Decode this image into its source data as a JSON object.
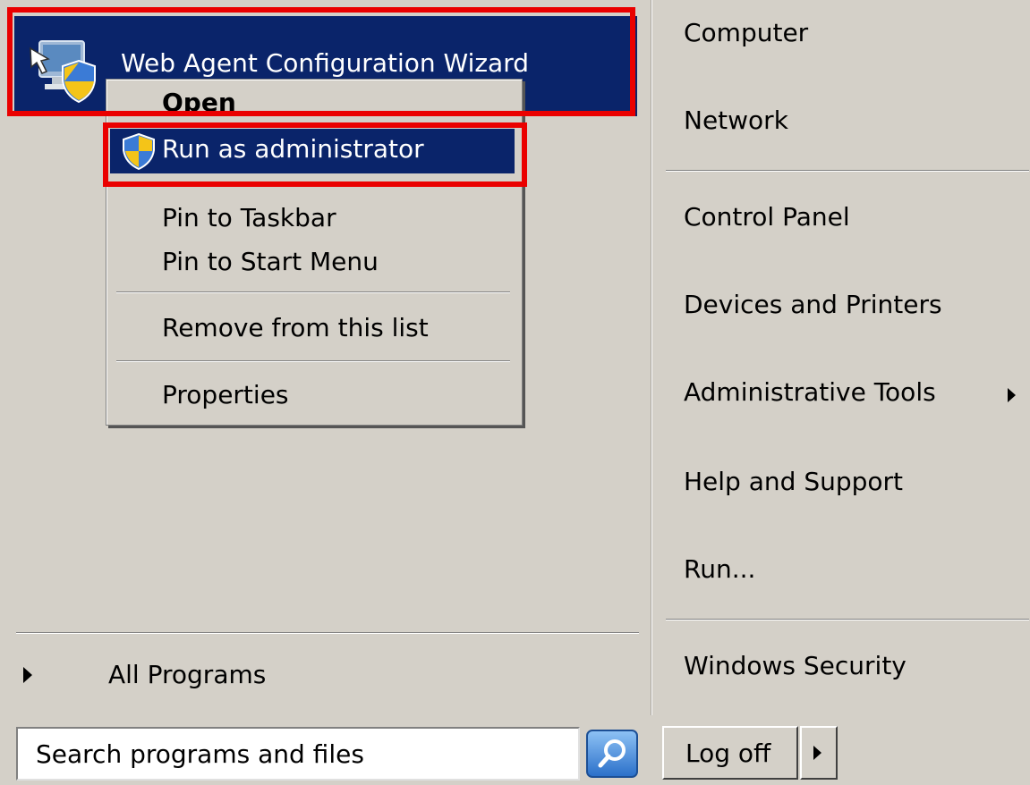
{
  "left_pane": {
    "pinned_program": {
      "label": "Web Agent Configuration Wizard",
      "icon": "computer-shield-icon"
    },
    "context_menu": {
      "items": [
        {
          "label": "Open",
          "bold": true
        },
        {
          "label": "Run as administrator",
          "icon": "uac-shield-icon",
          "selected": true
        },
        {
          "label": "Pin to Taskbar"
        },
        {
          "label": "Pin to Start Menu"
        },
        {
          "label": "Remove from this list"
        },
        {
          "label": "Properties"
        }
      ]
    },
    "all_programs": {
      "label": "All Programs",
      "icon": "right-triangle-icon"
    }
  },
  "right_pane": {
    "items": [
      {
        "label": "Computer"
      },
      {
        "label": "Network"
      },
      {
        "label": "Control Panel"
      },
      {
        "label": "Devices and Printers"
      },
      {
        "label": "Administrative Tools",
        "has_submenu": true
      },
      {
        "label": "Help and Support"
      },
      {
        "label": "Run..."
      },
      {
        "label": "Windows Security"
      }
    ]
  },
  "bottom_bar": {
    "search": {
      "placeholder": "Search programs and files",
      "icon": "search-icon"
    },
    "logoff": {
      "label": "Log off",
      "icon": "right-triangle-icon"
    }
  },
  "colors": {
    "background": "#d4d0c8",
    "selection": "#0a246a",
    "highlight_box": "#ea0000"
  }
}
